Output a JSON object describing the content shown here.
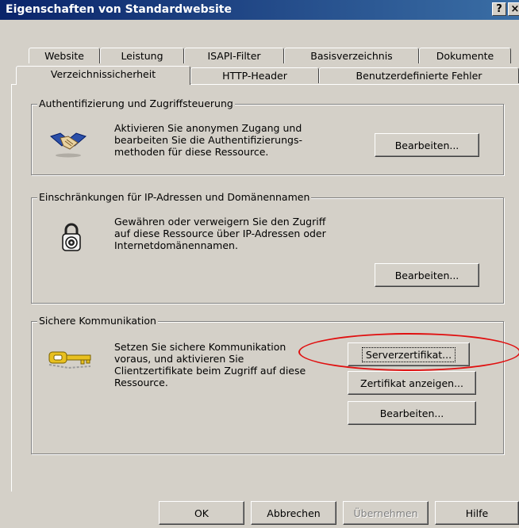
{
  "dialog": {
    "title": "Eigenschaften von Standardwebsite",
    "help_button": "?",
    "close_button": "×"
  },
  "tabs": {
    "row_back": [
      "Website",
      "Leistung",
      "ISAPI-Filter",
      "Basisverzeichnis",
      "Dokumente"
    ],
    "row_front": [
      "Verzeichnissicherheit",
      "HTTP-Header",
      "Benutzerdefinierte Fehler"
    ],
    "active": "Verzeichnissicherheit"
  },
  "auth": {
    "legend": "Authentifizierung und Zugriffsteuerung",
    "text": "Aktivieren Sie anonymen Zugang und\nbearbeiten Sie die Authentifizierungs-\nmethoden für diese Ressource.",
    "edit_button": "Bearbeiten...",
    "icon": "handshake-icon"
  },
  "ip": {
    "legend": "Einschränkungen für IP-Adressen und Domänennamen",
    "text": "Gewähren oder verweigern Sie den Zugriff\nauf diese Ressource über IP-Adressen oder\nInternetdomänennamen.",
    "edit_button": "Bearbeiten...",
    "icon": "padlock-icon"
  },
  "secure": {
    "legend": "Sichere Kommunikation",
    "text": "Setzen Sie sichere Kommunikation\nvoraus, und aktivieren Sie\nClientzertifikate beim Zugriff auf diese\nRessource.",
    "server_cert_button": "Serverzertifikat...",
    "view_cert_button": "Zertifikat anzeigen...",
    "edit_button": "Bearbeiten...",
    "icon": "key-icon"
  },
  "footer": {
    "ok": "OK",
    "cancel": "Abbrechen",
    "apply": "Übernehmen",
    "help": "Hilfe"
  },
  "colors": {
    "titlebar_start": "#0a246a",
    "titlebar_end": "#3a6ea5",
    "face": "#d4d0c8",
    "annotation_red": "#e01010"
  }
}
